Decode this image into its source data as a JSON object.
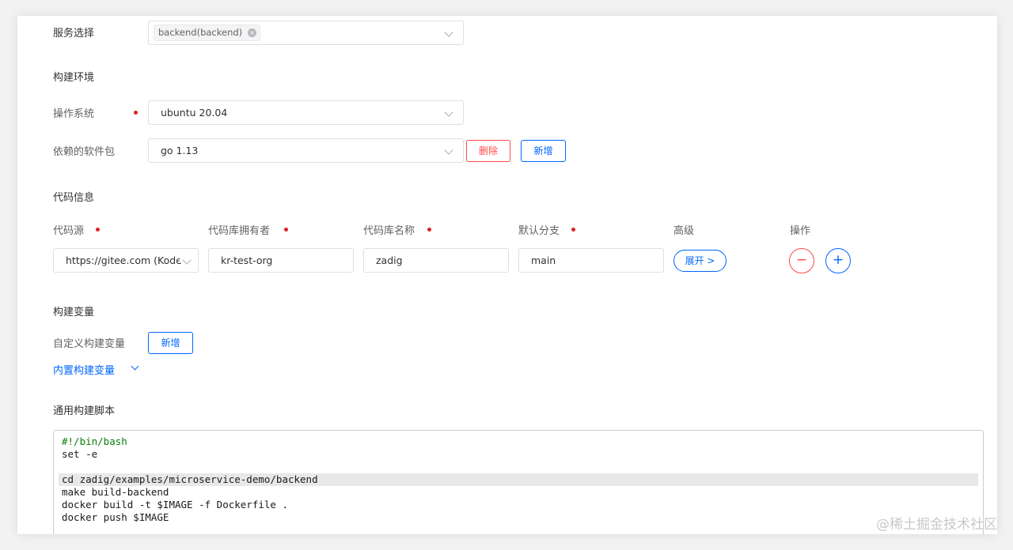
{
  "service_select": {
    "label": "服务选择",
    "tag": "backend(backend)",
    "tag_close": "×"
  },
  "build_env": {
    "title": "构建环境",
    "os_label": "操作系统",
    "os_value": "ubuntu 20.04",
    "deps_label": "依赖的软件包",
    "deps_value": "go 1.13",
    "delete_button": "删除",
    "add_button": "新增"
  },
  "code_info": {
    "title": "代码信息",
    "headers": {
      "source": "代码源",
      "owner": "代码库拥有者",
      "repo": "代码库名称",
      "branch": "默认分支",
      "advanced": "高级",
      "actions": "操作"
    },
    "row": {
      "source": "https://gitee.com (Kode",
      "owner": "kr-test-org",
      "repo": "zadig",
      "branch": "main",
      "expand_button": "展开 >",
      "remove_symbol": "−",
      "add_symbol": "+"
    }
  },
  "build_vars": {
    "title": "构建变量",
    "custom_label": "自定义构建变量",
    "add_button": "新增",
    "builtin_link": "内置构建变量"
  },
  "script": {
    "title": "通用构建脚本",
    "lines": [
      "#!/bin/bash",
      "set -e",
      "",
      "cd zadig/examples/microservice-demo/backend",
      "make build-backend",
      "docker build -t $IMAGE -f Dockerfile .",
      "docker push $IMAGE"
    ]
  },
  "watermark": "@稀土掘金技术社区",
  "colors": {
    "primary": "#0066ff",
    "danger": "#ff4949",
    "required_dot": "#e02020"
  }
}
